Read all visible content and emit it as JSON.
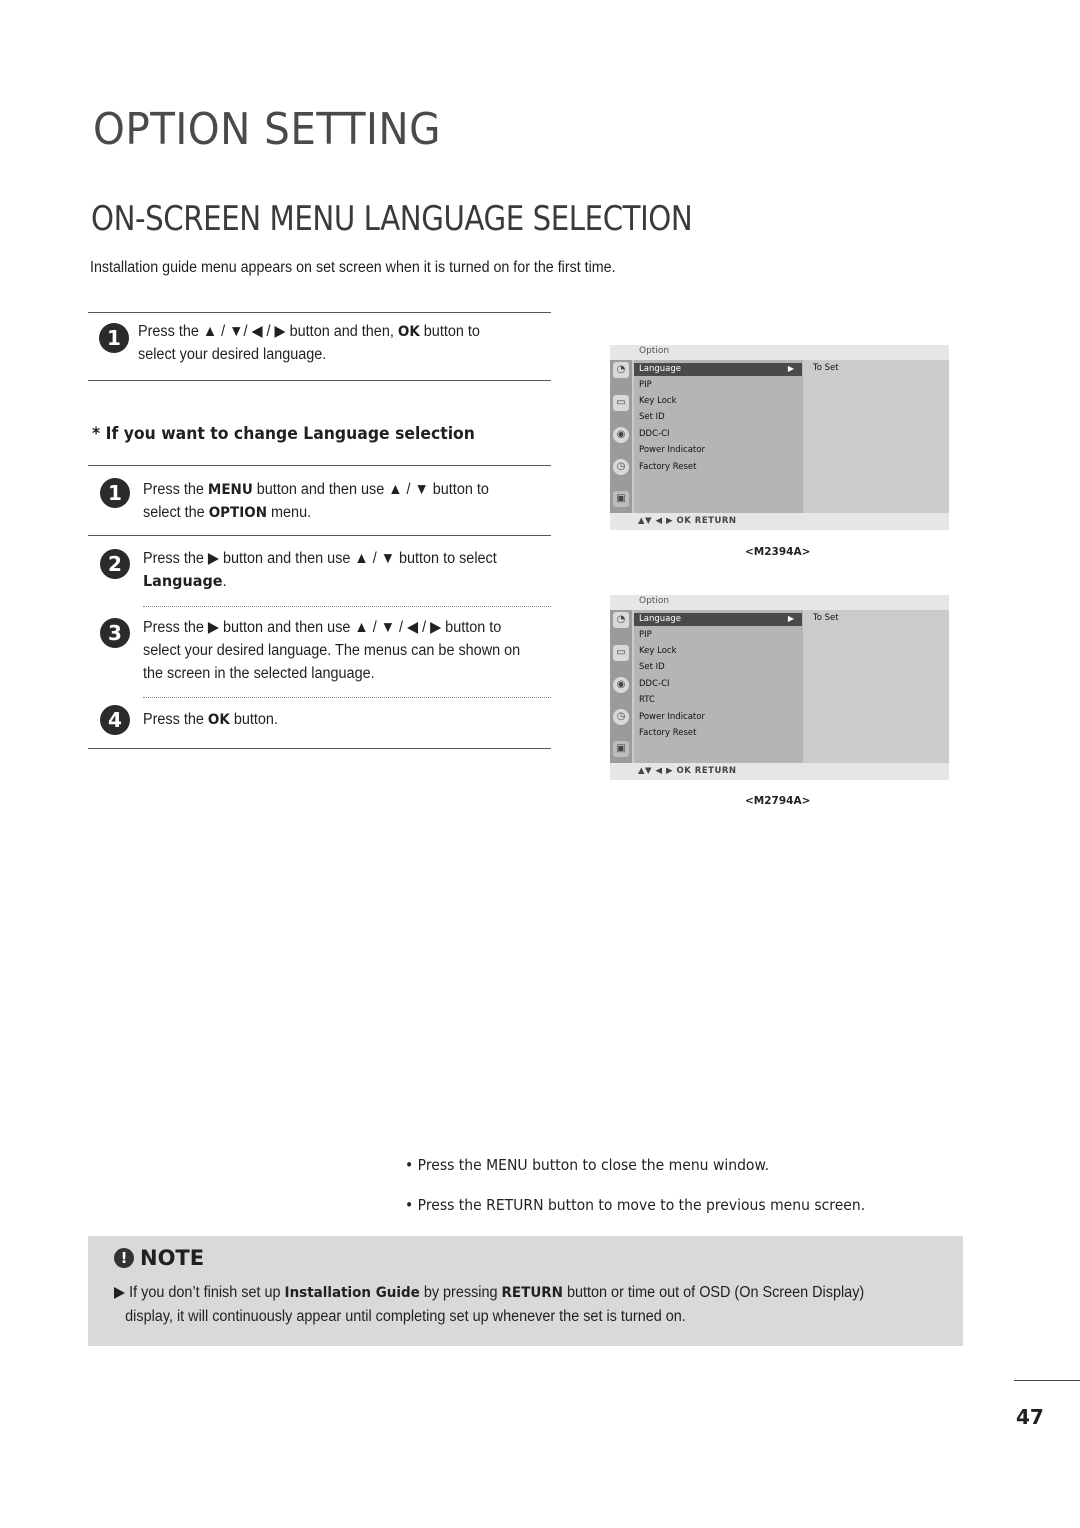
{
  "page": {
    "title": "OPTION SETTING",
    "section_title": "ON-SCREEN MENU LANGUAGE SELECTION",
    "intro": "Installation guide menu appears on set screen when it is turned on for the first time.",
    "page_number": "47"
  },
  "first_step": {
    "number": "1",
    "pre": "Press the ▲ / ▼/ ◀ / ▶ button and then, ",
    "key": "OK",
    "post": " button to",
    "line2": "select your desired language."
  },
  "change_heading": "* If you want to change Language selection",
  "steps": [
    {
      "number": "1",
      "a": "Press the ",
      "k1": "MENU",
      "b": " button and then use ▲ / ▼  button to",
      "c": "select the ",
      "k2": "OPTION",
      "d": " menu."
    },
    {
      "number": "2",
      "a": "Press the ▶ button and then use ▲ / ▼ button to select",
      "k1": "Language",
      "b": "."
    },
    {
      "number": "3",
      "line1": "Press the ▶ button and then use ▲ / ▼ / ◀ / ▶ button to",
      "line2": "select your desired language.  The menus can be shown on",
      "line3": "the screen in the selected language."
    },
    {
      "number": "4",
      "a": "Press the ",
      "k1": "OK",
      "b": " button."
    }
  ],
  "osd_menus": [
    {
      "model": "<M2394A>",
      "title": "Option",
      "items": [
        "Language",
        "PIP",
        "Key Lock",
        "Set ID",
        "DDC-CI",
        "Power Indicator",
        "Factory Reset"
      ],
      "selected": "Language",
      "selected_arrow": "▶",
      "right_text": "To Set",
      "footer": "▲▼  ◀ ▶  OK  RETURN",
      "icons": [
        "satellite-icon",
        "tv-icon",
        "speaker-icon",
        "clock-icon",
        "option-icon"
      ]
    },
    {
      "model": "<M2794A>",
      "title": "Option",
      "items": [
        "Language",
        "PIP",
        "Key Lock",
        "Set ID",
        "DDC-CI",
        "RTC",
        "Power Indicator",
        "Factory Reset"
      ],
      "selected": "Language",
      "selected_arrow": "▶",
      "right_text": "To Set",
      "footer": "▲▼  ◀ ▶  OK  RETURN",
      "icons": [
        "satellite-icon",
        "tv-icon",
        "speaker-icon",
        "clock-icon",
        "option-icon"
      ]
    }
  ],
  "bullets": [
    {
      "a": "• Press the ",
      "k": "MENU",
      "b": " button to close the menu window."
    },
    {
      "a": "• Press the ",
      "k": "RETURN",
      "b": " button to move to the previous menu screen."
    }
  ],
  "note": {
    "icon": "!",
    "heading": "NOTE",
    "a": "▶ If you don’t finish set up ",
    "k1": "Installation Guide",
    "b": " by pressing ",
    "k2": "RETURN",
    "c": " button or time out of OSD (On Screen Display)",
    "line2": "display, it will continuously appear until completing set up whenever the set is turned on."
  }
}
